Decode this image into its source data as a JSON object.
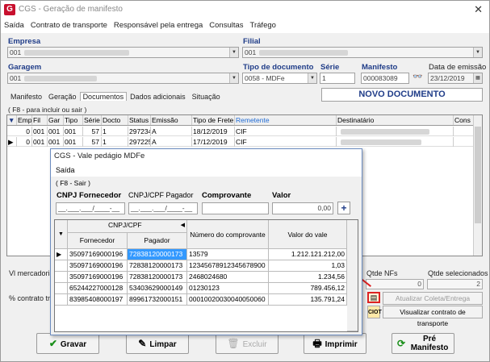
{
  "window": {
    "title": "CGS - Geração de manifesto",
    "close": "✕"
  },
  "menu": [
    "Saída",
    "Contrato de transporte",
    "Responsável pela entrega",
    "Consultas",
    "Tráfego"
  ],
  "form": {
    "empresa_label": "Empresa",
    "empresa_value": "001",
    "filial_label": "Filial",
    "filial_value": "001",
    "garagem_label": "Garagem",
    "garagem_value": "001",
    "tipo_doc_label": "Tipo de documento",
    "tipo_doc_value": "0058 - MDFe",
    "serie_label": "Série",
    "serie_value": "1",
    "manifesto_label": "Manifesto",
    "manifesto_value": "000083089",
    "data_emissao_label": "Data de emissão",
    "data_emissao_value": "23/12/2019",
    "status_banner": "NOVO DOCUMENTO"
  },
  "tabs": [
    "Manifesto",
    "Geração",
    "Documentos",
    "Dados adicionais",
    "Situação"
  ],
  "grid_hint": "( F8 - para incluir ou sair )",
  "grid": {
    "headers": [
      "",
      "Emp",
      "Fil",
      "Gar",
      "Tipo",
      "Série",
      "Docto",
      "Status",
      "Emissão",
      "Tipo de Frete",
      "Remetente",
      "Destinatário",
      "Cons"
    ],
    "rows": [
      [
        "0",
        "001",
        "001",
        "001",
        "57",
        "1",
        "297234",
        "A",
        "18/12/2019",
        "CIF"
      ],
      [
        "0",
        "001",
        "001",
        "001",
        "57",
        "1",
        "297225",
        "A",
        "17/12/2019",
        "CIF"
      ]
    ]
  },
  "summary": {
    "vl_mercadoria": "Vl mercadoria",
    "pct_contrato": "% contrato tra",
    "qtde_nfs_label": "Qtde NFs",
    "qtde_nfs_value": "0",
    "qtde_sel_label": "Qtde selecionados",
    "qtde_sel_value": "2"
  },
  "side_buttons": {
    "atualizar": "Atualizar Coleta/Entrega",
    "visualizar": "Visualizar contrato de transporte"
  },
  "buttons": {
    "gravar": "Gravar",
    "limpar": "Limpar",
    "excluir": "Excluir",
    "imprimir": "Imprimir",
    "pre_manifesto_1": "Pré",
    "pre_manifesto_2": "Manifesto"
  },
  "dialog": {
    "title": "CGS - Vale pedágio MDFe",
    "menu": "Saída",
    "hint": "( F8 - Sair )",
    "cnpj_fornecedor_label": "CNPJ Fornecedor",
    "cnpj_pagador_label": "CNPJ/CPF Pagador",
    "comprovante_label": "Comprovante",
    "valor_label": "Valor",
    "cnpj_fornecedor_mask": "__.___.___/____-__",
    "cnpj_pagador_mask": "__.___.___/____-__",
    "valor_value": "0,00",
    "add": "+",
    "grid_headers": {
      "group": "CNPJ/CPF",
      "fornecedor": "Fornecedor",
      "pagador": "Pagador",
      "numero": "Número do comprovante",
      "valor": "Valor do vale"
    },
    "rows": [
      {
        "fornecedor": "35097169000196",
        "pagador": "72838120000173",
        "numero": "13579",
        "valor": "1.212.121.212,00"
      },
      {
        "fornecedor": "35097169000196",
        "pagador": "72838120000173",
        "numero": "12345678912345678900",
        "valor": "1,03"
      },
      {
        "fornecedor": "35097169000196",
        "pagador": "72838120000173",
        "numero": "2468024680",
        "valor": "1.234,56"
      },
      {
        "fornecedor": "65244227000128",
        "pagador": "53403629000149",
        "numero": "01230123",
        "valor": "789.456,12"
      },
      {
        "fornecedor": "83985408000197",
        "pagador": "89961732000151",
        "numero": "00010020030040050060",
        "valor": "135.791,24"
      }
    ]
  },
  "colors": {
    "accent": "#1f3c88",
    "selection": "#3399ff",
    "brand": "#c8102e"
  }
}
